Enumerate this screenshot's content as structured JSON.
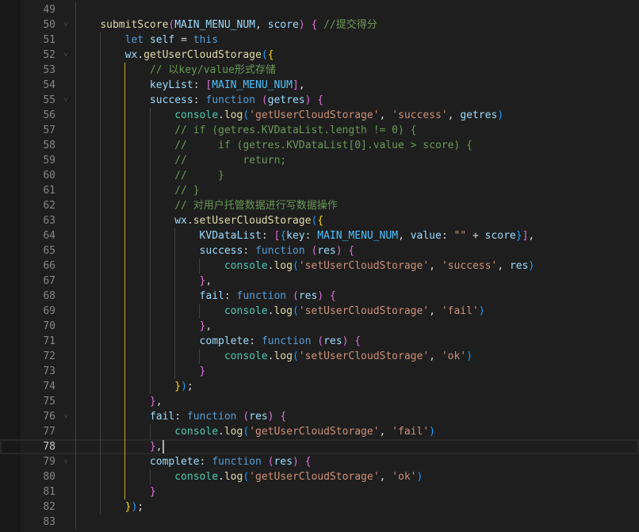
{
  "editor": {
    "current_line": 78,
    "active_guide": {
      "level": 2,
      "from": 53,
      "to": 81
    },
    "folds": [
      50,
      52,
      55,
      76,
      79
    ],
    "lines": [
      {
        "n": 49,
        "i": 0,
        "t": []
      },
      {
        "n": 50,
        "i": 4,
        "t": [
          [
            "submitScore",
            "f"
          ],
          [
            "(",
            "b2"
          ],
          [
            "MAIN_MENU_NUM",
            "v"
          ],
          [
            ", ",
            "p"
          ],
          [
            "score",
            "v"
          ],
          [
            ")",
            "b2"
          ],
          [
            " ",
            "p"
          ],
          [
            "{",
            "b2"
          ],
          [
            " //提交得分",
            "m"
          ]
        ]
      },
      {
        "n": 51,
        "i": 8,
        "t": [
          [
            "let",
            "k"
          ],
          [
            " ",
            "p"
          ],
          [
            "self",
            "v"
          ],
          [
            " = ",
            "p"
          ],
          [
            "this",
            "k"
          ]
        ]
      },
      {
        "n": 52,
        "i": 8,
        "t": [
          [
            "wx",
            "v"
          ],
          [
            ".",
            "p"
          ],
          [
            "getUserCloudStorage",
            "f"
          ],
          [
            "(",
            "b3"
          ],
          [
            "{",
            "b1"
          ]
        ]
      },
      {
        "n": 53,
        "i": 12,
        "t": [
          [
            "// 以key/value形式存储",
            "m"
          ]
        ]
      },
      {
        "n": 54,
        "i": 12,
        "t": [
          [
            "keyList",
            "v"
          ],
          [
            ": ",
            "p"
          ],
          [
            "[",
            "b2"
          ],
          [
            "MAIN_MENU_NUM",
            "c"
          ],
          [
            "]",
            "b2"
          ],
          [
            ",",
            "p"
          ]
        ]
      },
      {
        "n": 55,
        "i": 12,
        "t": [
          [
            "success",
            "v"
          ],
          [
            ": ",
            "p"
          ],
          [
            "function",
            "k"
          ],
          [
            " ",
            "p"
          ],
          [
            "(",
            "b2"
          ],
          [
            "getres",
            "v"
          ],
          [
            ")",
            "b2"
          ],
          [
            " ",
            "p"
          ],
          [
            "{",
            "b2"
          ]
        ]
      },
      {
        "n": 56,
        "i": 16,
        "t": [
          [
            "console",
            "t"
          ],
          [
            ".",
            "p"
          ],
          [
            "log",
            "f"
          ],
          [
            "(",
            "b3"
          ],
          [
            "'getUserCloudStorage'",
            "s"
          ],
          [
            ", ",
            "p"
          ],
          [
            "'success'",
            "s"
          ],
          [
            ", ",
            "p"
          ],
          [
            "getres",
            "v"
          ],
          [
            ")",
            "b3"
          ]
        ]
      },
      {
        "n": 57,
        "i": 16,
        "t": [
          [
            "// if (getres.KVDataList.length != 0) {",
            "m"
          ]
        ]
      },
      {
        "n": 58,
        "i": 16,
        "t": [
          [
            "//     if (getres.KVDataList[0].value > score) {",
            "m"
          ]
        ]
      },
      {
        "n": 59,
        "i": 16,
        "t": [
          [
            "//         return;",
            "m"
          ]
        ]
      },
      {
        "n": 60,
        "i": 16,
        "t": [
          [
            "//     }",
            "m"
          ]
        ]
      },
      {
        "n": 61,
        "i": 16,
        "t": [
          [
            "// }",
            "m"
          ]
        ]
      },
      {
        "n": 62,
        "i": 16,
        "t": [
          [
            "// 对用户托管数据进行写数据操作",
            "m"
          ]
        ]
      },
      {
        "n": 63,
        "i": 16,
        "t": [
          [
            "wx",
            "v"
          ],
          [
            ".",
            "p"
          ],
          [
            "setUserCloudStorage",
            "f"
          ],
          [
            "(",
            "b3"
          ],
          [
            "{",
            "b1"
          ]
        ]
      },
      {
        "n": 64,
        "i": 20,
        "t": [
          [
            "KVDataList",
            "v"
          ],
          [
            ": ",
            "p"
          ],
          [
            "[",
            "b2"
          ],
          [
            "{",
            "b3"
          ],
          [
            "key",
            "v"
          ],
          [
            ": ",
            "p"
          ],
          [
            "MAIN_MENU_NUM",
            "c"
          ],
          [
            ", ",
            "p"
          ],
          [
            "value",
            "v"
          ],
          [
            ": ",
            "p"
          ],
          [
            "\"\"",
            "s"
          ],
          [
            " + ",
            "p"
          ],
          [
            "score",
            "v"
          ],
          [
            "}",
            "b3"
          ],
          [
            "]",
            "b2"
          ],
          [
            ",",
            "p"
          ]
        ]
      },
      {
        "n": 65,
        "i": 20,
        "t": [
          [
            "success",
            "v"
          ],
          [
            ": ",
            "p"
          ],
          [
            "function",
            "k"
          ],
          [
            " ",
            "p"
          ],
          [
            "(",
            "b2"
          ],
          [
            "res",
            "v"
          ],
          [
            ")",
            "b2"
          ],
          [
            " ",
            "p"
          ],
          [
            "{",
            "b2"
          ]
        ]
      },
      {
        "n": 66,
        "i": 24,
        "t": [
          [
            "console",
            "t"
          ],
          [
            ".",
            "p"
          ],
          [
            "log",
            "f"
          ],
          [
            "(",
            "b3"
          ],
          [
            "'setUserCloudStorage'",
            "s"
          ],
          [
            ", ",
            "p"
          ],
          [
            "'success'",
            "s"
          ],
          [
            ", ",
            "p"
          ],
          [
            "res",
            "v"
          ],
          [
            ")",
            "b3"
          ]
        ]
      },
      {
        "n": 67,
        "i": 20,
        "t": [
          [
            "}",
            "b2"
          ],
          [
            ",",
            "p"
          ]
        ]
      },
      {
        "n": 68,
        "i": 20,
        "t": [
          [
            "fail",
            "v"
          ],
          [
            ": ",
            "p"
          ],
          [
            "function",
            "k"
          ],
          [
            " ",
            "p"
          ],
          [
            "(",
            "b2"
          ],
          [
            "res",
            "v"
          ],
          [
            ")",
            "b2"
          ],
          [
            " ",
            "p"
          ],
          [
            "{",
            "b2"
          ]
        ]
      },
      {
        "n": 69,
        "i": 24,
        "t": [
          [
            "console",
            "t"
          ],
          [
            ".",
            "p"
          ],
          [
            "log",
            "f"
          ],
          [
            "(",
            "b3"
          ],
          [
            "'setUserCloudStorage'",
            "s"
          ],
          [
            ", ",
            "p"
          ],
          [
            "'fail'",
            "s"
          ],
          [
            ")",
            "b3"
          ]
        ]
      },
      {
        "n": 70,
        "i": 20,
        "t": [
          [
            "}",
            "b2"
          ],
          [
            ",",
            "p"
          ]
        ]
      },
      {
        "n": 71,
        "i": 20,
        "t": [
          [
            "complete",
            "v"
          ],
          [
            ": ",
            "p"
          ],
          [
            "function",
            "k"
          ],
          [
            " ",
            "p"
          ],
          [
            "(",
            "b2"
          ],
          [
            "res",
            "v"
          ],
          [
            ")",
            "b2"
          ],
          [
            " ",
            "p"
          ],
          [
            "{",
            "b2"
          ]
        ]
      },
      {
        "n": 72,
        "i": 24,
        "t": [
          [
            "console",
            "t"
          ],
          [
            ".",
            "p"
          ],
          [
            "log",
            "f"
          ],
          [
            "(",
            "b3"
          ],
          [
            "'setUserCloudStorage'",
            "s"
          ],
          [
            ", ",
            "p"
          ],
          [
            "'ok'",
            "s"
          ],
          [
            ")",
            "b3"
          ]
        ]
      },
      {
        "n": 73,
        "i": 20,
        "t": [
          [
            "}",
            "b2"
          ]
        ]
      },
      {
        "n": 74,
        "i": 16,
        "t": [
          [
            "}",
            "b1"
          ],
          [
            ")",
            "b3"
          ],
          [
            ";",
            "p"
          ]
        ]
      },
      {
        "n": 75,
        "i": 12,
        "t": [
          [
            "}",
            "b2"
          ],
          [
            ",",
            "p"
          ]
        ]
      },
      {
        "n": 76,
        "i": 12,
        "t": [
          [
            "fail",
            "v"
          ],
          [
            ": ",
            "p"
          ],
          [
            "function",
            "k"
          ],
          [
            " ",
            "p"
          ],
          [
            "(",
            "b2"
          ],
          [
            "res",
            "v"
          ],
          [
            ")",
            "b2"
          ],
          [
            " ",
            "p"
          ],
          [
            "{",
            "b2"
          ]
        ]
      },
      {
        "n": 77,
        "i": 16,
        "t": [
          [
            "console",
            "t"
          ],
          [
            ".",
            "p"
          ],
          [
            "log",
            "f"
          ],
          [
            "(",
            "b3"
          ],
          [
            "'getUserCloudStorage'",
            "s"
          ],
          [
            ", ",
            "p"
          ],
          [
            "'fail'",
            "s"
          ],
          [
            ")",
            "b3"
          ]
        ]
      },
      {
        "n": 78,
        "i": 12,
        "t": [
          [
            "}",
            "b2"
          ],
          [
            ",",
            "p"
          ]
        ]
      },
      {
        "n": 79,
        "i": 12,
        "t": [
          [
            "complete",
            "v"
          ],
          [
            ": ",
            "p"
          ],
          [
            "function",
            "k"
          ],
          [
            " ",
            "p"
          ],
          [
            "(",
            "b2"
          ],
          [
            "res",
            "v"
          ],
          [
            ")",
            "b2"
          ],
          [
            " ",
            "p"
          ],
          [
            "{",
            "b2"
          ]
        ]
      },
      {
        "n": 80,
        "i": 16,
        "t": [
          [
            "console",
            "t"
          ],
          [
            ".",
            "p"
          ],
          [
            "log",
            "f"
          ],
          [
            "(",
            "b3"
          ],
          [
            "'getUserCloudStorage'",
            "s"
          ],
          [
            ", ",
            "p"
          ],
          [
            "'ok'",
            "s"
          ],
          [
            ")",
            "b3"
          ]
        ]
      },
      {
        "n": 81,
        "i": 12,
        "t": [
          [
            "}",
            "b2"
          ]
        ]
      },
      {
        "n": 82,
        "i": 8,
        "t": [
          [
            "}",
            "b1"
          ],
          [
            ")",
            "b3"
          ],
          [
            ";",
            "p"
          ]
        ]
      },
      {
        "n": 83,
        "i": 4,
        "t": []
      }
    ]
  }
}
